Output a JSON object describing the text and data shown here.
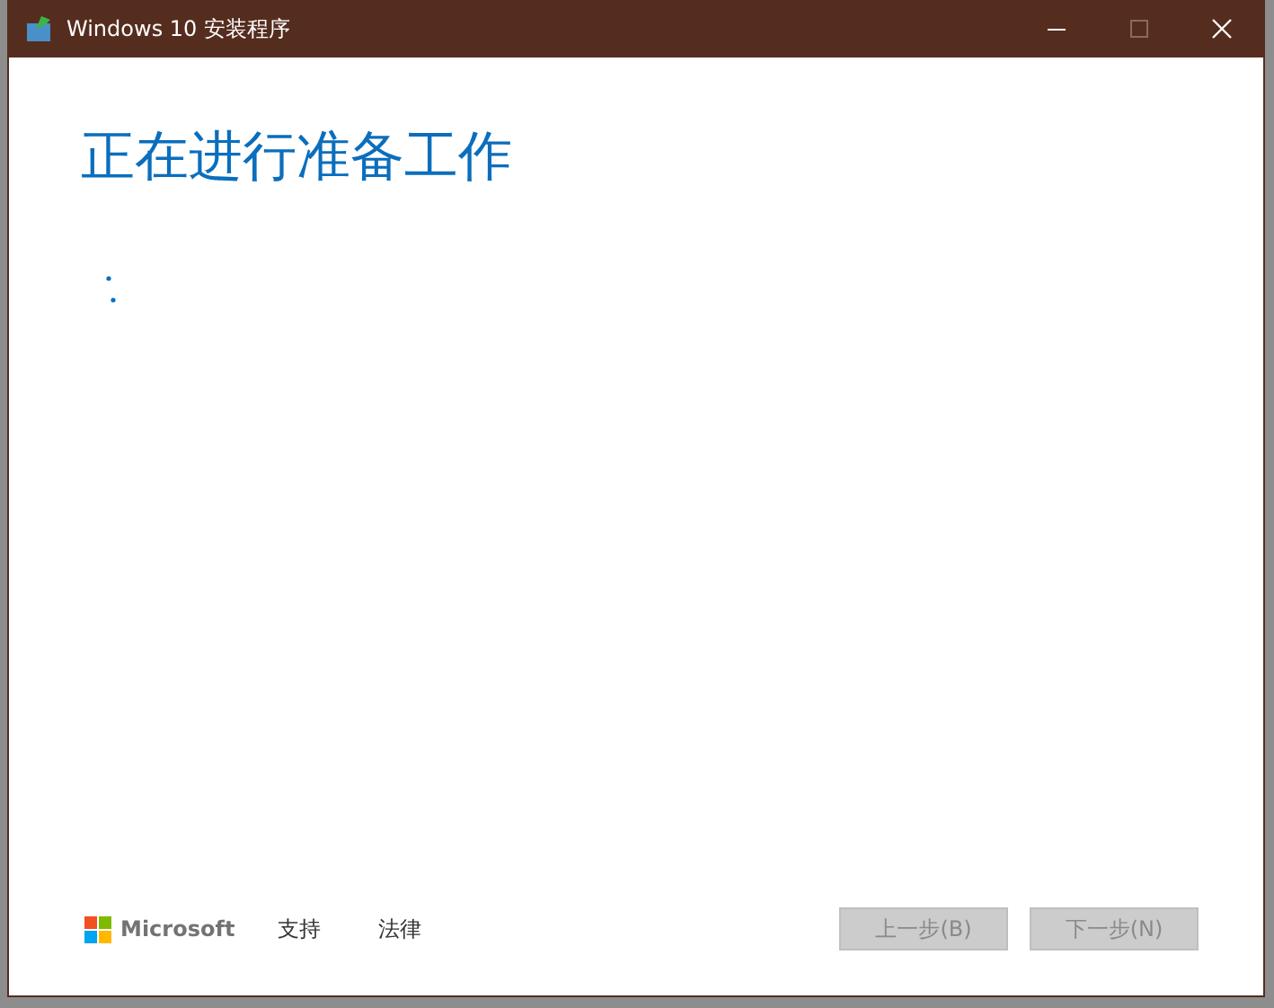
{
  "window": {
    "title": "Windows 10 安装程序",
    "maximize_disabled": true
  },
  "heading": "正在进行准备工作",
  "footer": {
    "brand": "Microsoft",
    "links": [
      "支持",
      "法律"
    ]
  },
  "buttons": [
    {
      "label": "上一步(B)",
      "disabled": true
    },
    {
      "label": "下一步(N)",
      "disabled": true
    }
  ]
}
